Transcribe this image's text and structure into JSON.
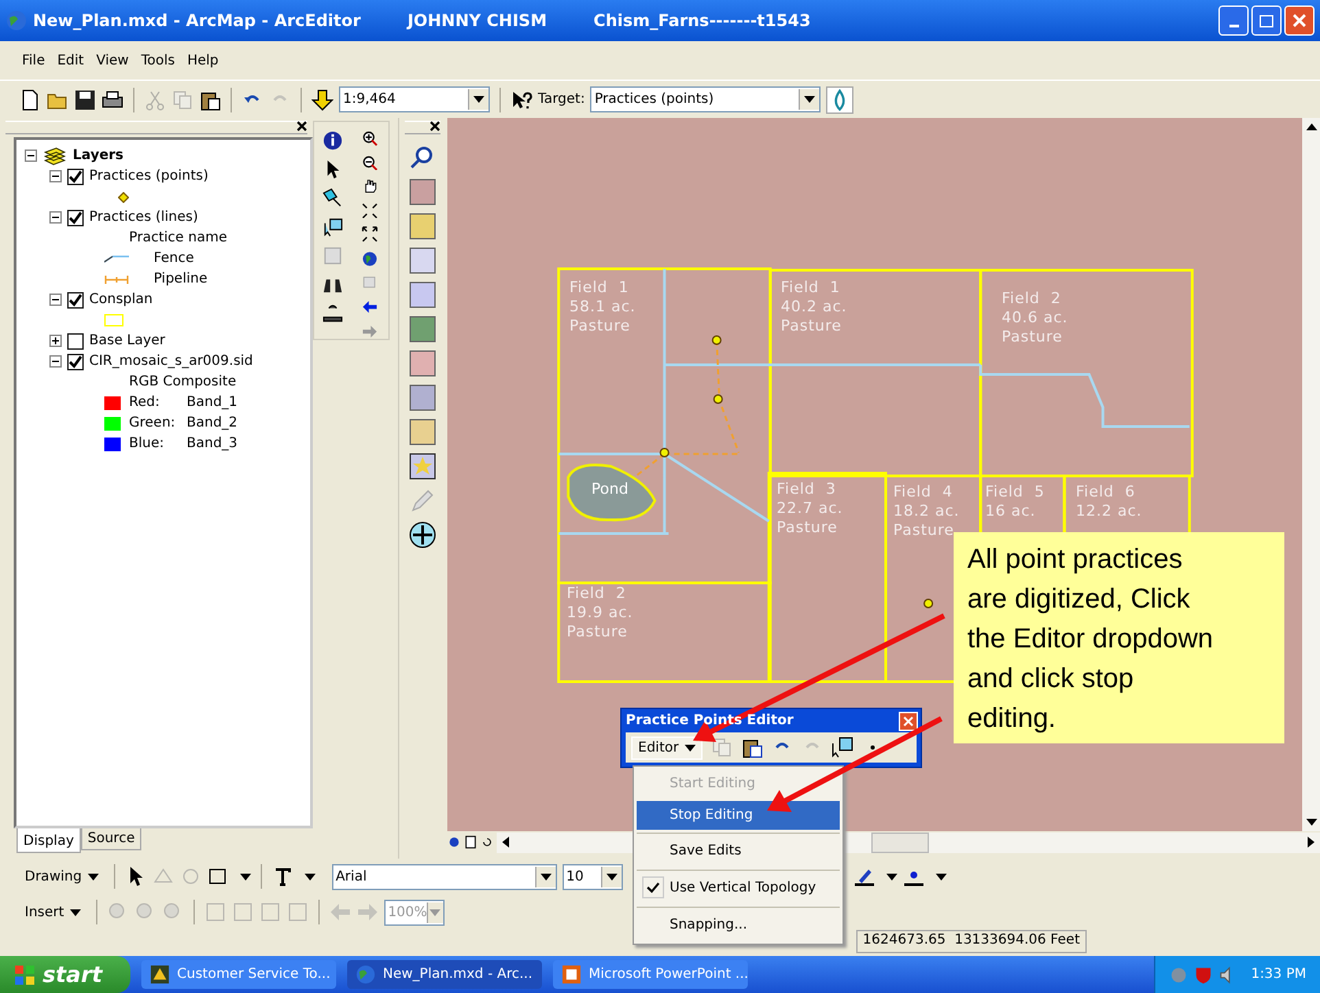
{
  "window": {
    "title": "New_Plan.mxd - ArcMap - ArcEditor",
    "user": "JOHNNY CHISM",
    "project": "Chism_Farns-------t1543"
  },
  "menu": [
    "File",
    "Edit",
    "View",
    "Tools",
    "Help"
  ],
  "toolbar": {
    "scale": "1:9,464",
    "target_label": "Target:",
    "target": "Practices (points)"
  },
  "toc": {
    "root": "Layers",
    "expanded": true,
    "layers": [
      {
        "label": "Practices (points)",
        "checked": true,
        "expanded": true,
        "legend": [
          {
            "kind": "point"
          }
        ]
      },
      {
        "label": "Practices (lines)",
        "checked": true,
        "expanded": true,
        "legend": [
          {
            "kind": "heading",
            "label": "Practice name"
          },
          {
            "kind": "fence",
            "label": "Fence"
          },
          {
            "kind": "pipeline",
            "label": "Pipeline"
          }
        ]
      },
      {
        "label": "Consplan",
        "checked": true,
        "expanded": true,
        "legend": [
          {
            "kind": "polygon"
          }
        ]
      },
      {
        "label": "Base Layer",
        "checked": false,
        "expanded": false
      },
      {
        "label": "CIR_mosaic_s_ar009.sid",
        "checked": true,
        "expanded": true,
        "legend": [
          {
            "kind": "heading",
            "label": "RGB Composite"
          },
          {
            "kind": "swatch",
            "label": "Red:",
            "value": "Band_1",
            "color": "#ff0000"
          },
          {
            "kind": "swatch",
            "label": "Green:",
            "value": "Band_2",
            "color": "#00ff00"
          },
          {
            "kind": "swatch",
            "label": "Blue:",
            "value": "Band_3",
            "color": "#0000ff"
          }
        ]
      }
    ]
  },
  "toc_tabs": [
    {
      "label": "Display",
      "selected": true
    },
    {
      "label": "Source",
      "selected": false
    }
  ],
  "map": {
    "fields": [
      {
        "lines": [
          "Field  1",
          "58.1 ac.",
          "Pasture"
        ]
      },
      {
        "lines": [
          "Field  1",
          "40.2 ac.",
          "Pasture"
        ]
      },
      {
        "lines": [
          "Field  2",
          "40.6 ac.",
          "Pasture"
        ]
      },
      {
        "lines": [
          "Field  3",
          "22.7 ac.",
          "Pasture"
        ]
      },
      {
        "lines": [
          "Field  4",
          "18.2 ac.",
          "Pasture"
        ]
      },
      {
        "lines": [
          "Field  5",
          "16 ac."
        ]
      },
      {
        "lines": [
          "Field  6",
          "12.2 ac."
        ]
      },
      {
        "lines": [
          "Field  2",
          "19.9 ac.",
          "Pasture"
        ]
      }
    ],
    "pond": "Pond"
  },
  "callout": "All point practices are digitized, Click the Editor dropdown and click stop editing.",
  "editor": {
    "title": "Practice Points Editor",
    "button": "Editor",
    "menu": [
      {
        "label": "Start Editing",
        "disabled": true,
        "selected": false,
        "checked": false
      },
      {
        "label": "Stop Editing",
        "disabled": false,
        "selected": true,
        "checked": false
      },
      {
        "label": "Save Edits",
        "disabled": false,
        "selected": false,
        "checked": false
      },
      {
        "label": "Use Vertical Topology",
        "disabled": false,
        "selected": false,
        "checked": true
      },
      {
        "label": "Snapping...",
        "disabled": false,
        "selected": false,
        "checked": false
      }
    ]
  },
  "drawing_toolbar": {
    "label": "Drawing",
    "font": "Arial",
    "size": "10"
  },
  "insert_toolbar": {
    "label": "Insert",
    "zoom": "100%"
  },
  "status_bar": {
    "coordinates": "1624673.65  13133694.06 Feet"
  },
  "taskbar": {
    "start": "start",
    "tasks": [
      {
        "label": "Customer Service To...",
        "selected": false
      },
      {
        "label": "New_Plan.mxd - Arc...",
        "selected": true
      },
      {
        "label": "Microsoft PowerPoint ...",
        "selected": false
      }
    ],
    "clock": "1:33 PM"
  }
}
